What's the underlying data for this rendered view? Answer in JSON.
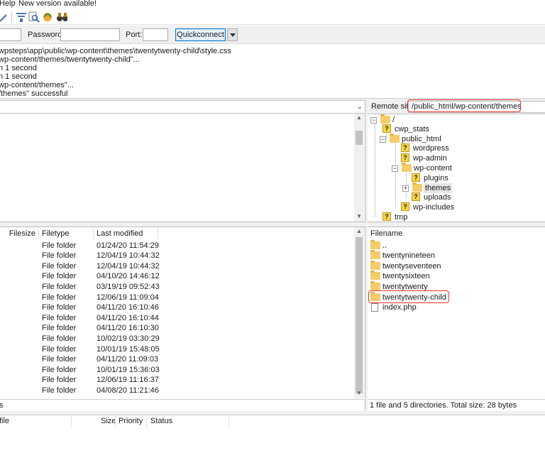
{
  "menubar": {
    "items": [
      "Help",
      "New version available!"
    ]
  },
  "toolbar": {
    "icons": [
      "pencil-icon",
      "filter-icon",
      "search-remote-icon",
      "sync-icon",
      "binoculars-icon"
    ]
  },
  "quickconnect": {
    "password_label": "Password:",
    "port_label": "Port:",
    "button_label": "Quickconnect"
  },
  "log": {
    "lines": [
      "wpsteps\\app\\public\\wp-content\\themes\\twentytwenty-child\\style.css",
      "wp-content/themes/twentytwenty-child\"...",
      "n 1 second",
      "n 1 second",
      "wp-content/themes\"...",
      "/themes\" successful"
    ]
  },
  "remote": {
    "site_label": "Remote site:",
    "site_path": "/public_html/wp-content/themes",
    "tree": [
      {
        "label": "/"
      },
      {
        "label": "cwp_stats"
      },
      {
        "label": "public_html"
      },
      {
        "label": "wordpress"
      },
      {
        "label": "wp-admin"
      },
      {
        "label": "wp-content"
      },
      {
        "label": "plugins"
      },
      {
        "label": "themes"
      },
      {
        "label": "uploads"
      },
      {
        "label": "wp-includes"
      },
      {
        "label": "tmp"
      }
    ],
    "list_header": "Filename",
    "files": [
      "..",
      "twentynineteen",
      "twentyseventeen",
      "twentysixteen",
      "twentytwenty",
      "twentytwenty-child",
      "index.php"
    ],
    "status": "1 file and 5 directories. Total size: 28 bytes"
  },
  "local": {
    "headers": {
      "filesize": "Filesize",
      "filetype": "Filetype",
      "last_modified": "Last modified"
    },
    "rows": [
      {
        "type": "File folder",
        "modified": "01/24/20 11:54:29"
      },
      {
        "type": "File folder",
        "modified": "12/04/19 10:44:32"
      },
      {
        "type": "File folder",
        "modified": "12/04/19 10:44:32"
      },
      {
        "type": "File folder",
        "modified": "04/10/20 14:46:12"
      },
      {
        "type": "File folder",
        "modified": "03/19/19 09:52:43"
      },
      {
        "type": "File folder",
        "modified": "12/06/19 11:09:04"
      },
      {
        "type": "File folder",
        "modified": "04/11/20 16:10:46"
      },
      {
        "type": "File folder",
        "modified": "04/11/20 16:10:44"
      },
      {
        "type": "File folder",
        "modified": "04/11/20 16:10:30"
      },
      {
        "type": "File folder",
        "modified": "10/02/19 03:30:29"
      },
      {
        "type": "File folder",
        "modified": "10/01/19 15:48:05"
      },
      {
        "type": "File folder",
        "modified": "04/11/20 11:09:03"
      },
      {
        "type": "File folder",
        "modified": "10/01/19 15:36:03"
      },
      {
        "type": "File folder",
        "modified": "12/06/19 11:16:37"
      },
      {
        "type": "File folder",
        "modified": "04/08/20 11:21:46"
      }
    ],
    "status": "s"
  },
  "queue": {
    "columns": {
      "file": "file",
      "size": "Size",
      "priority": "Priority",
      "status": "Status"
    }
  },
  "colors": {
    "highlight": "#e8322f",
    "accent": "#0078d7",
    "folder": "#f3cd6b"
  }
}
